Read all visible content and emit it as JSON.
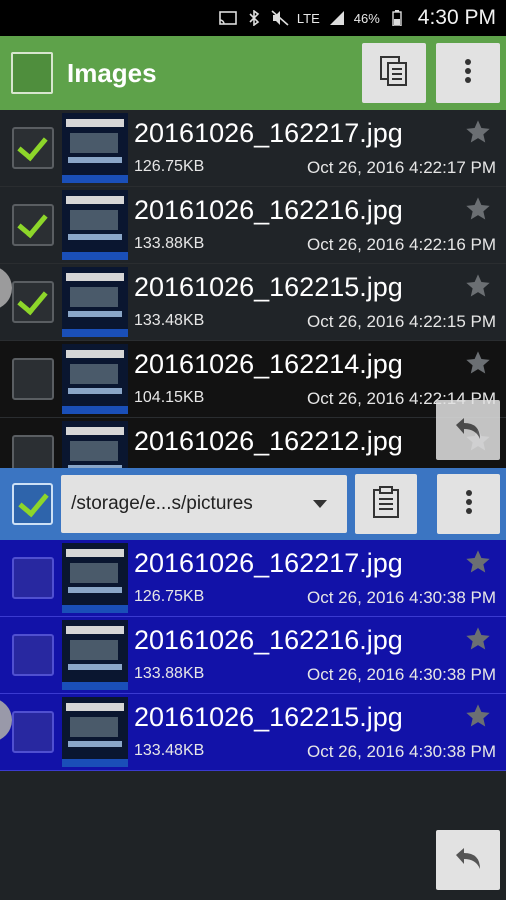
{
  "status_bar": {
    "network": "LTE",
    "battery": "46%",
    "time": "4:30 PM",
    "icons": [
      "cast-icon",
      "bluetooth-icon",
      "mute-icon",
      "signal-icon",
      "battery-icon"
    ]
  },
  "header": {
    "title": "Images",
    "icons": [
      "copy-icon",
      "more-vert-icon"
    ]
  },
  "top_list": [
    {
      "name": "20161026_162217.jpg",
      "size": "126.75KB",
      "date": "Oct 26, 2016 4:22:17 PM",
      "checked": true
    },
    {
      "name": "20161026_162216.jpg",
      "size": "133.88KB",
      "date": "Oct 26, 2016 4:22:16 PM",
      "checked": true
    },
    {
      "name": "20161026_162215.jpg",
      "size": "133.48KB",
      "date": "Oct 26, 2016 4:22:15 PM",
      "checked": true
    },
    {
      "name": "20161026_162214.jpg",
      "size": "104.15KB",
      "date": "Oct 26, 2016 4:22:14 PM",
      "checked": false
    },
    {
      "name": "20161026_162212.jpg",
      "size": "",
      "date": "",
      "checked": false
    }
  ],
  "pathbar": {
    "path": "/storage/e...s/pictures",
    "icons": [
      "paste-icon",
      "more-vert-icon"
    ]
  },
  "bottom_list": [
    {
      "name": "20161026_162217.jpg",
      "size": "126.75KB",
      "date": "Oct 26, 2016 4:30:38 PM",
      "checked": false
    },
    {
      "name": "20161026_162216.jpg",
      "size": "133.88KB",
      "date": "Oct 26, 2016 4:30:38 PM",
      "checked": false
    },
    {
      "name": "20161026_162215.jpg",
      "size": "133.48KB",
      "date": "Oct 26, 2016 4:30:38 PM",
      "checked": false
    }
  ],
  "colors": {
    "header": "#5ea24a",
    "pathbar": "#3b75c2",
    "bottom_rows": "#1212a8",
    "check": "#8dd62a"
  }
}
